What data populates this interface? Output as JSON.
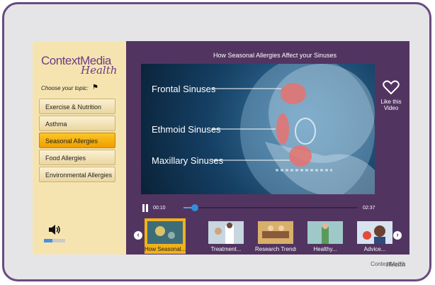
{
  "sidebar": {
    "logo_line1": "ContextMedia",
    "logo_line2": "Health",
    "choose_label": "Choose your topic:",
    "topics": [
      {
        "label": "Exercise & Nutrition"
      },
      {
        "label": "Asthma"
      },
      {
        "label": "Seasonal Allergies",
        "active": true
      },
      {
        "label": "Food Allergies"
      },
      {
        "label": "Environmental Allergies"
      }
    ],
    "volume_level": 0.4
  },
  "player": {
    "title": "How Seasonal Allergies Affect your Sinuses",
    "video_labels": [
      "Frontal Sinuses",
      "Ethmoid Sinuses",
      "Maxillary Sinuses"
    ],
    "like_label": "Like this Video",
    "current_time": "00:10",
    "total_time": "02:37",
    "progress_seconds": 10,
    "duration_seconds": 157
  },
  "thumbnails": [
    {
      "caption": "How Seasonal...",
      "active": true
    },
    {
      "caption": "Treatment..."
    },
    {
      "caption": "Research Trends"
    },
    {
      "caption": "Healthy..."
    },
    {
      "caption": "Advice..."
    }
  ],
  "colors": {
    "purple": "#523461",
    "gold": "#f1b11b",
    "cream": "#f6e4b0",
    "blue": "#2f8fd8"
  },
  "brand": {
    "line1": "ContextMedia",
    "line2": "Health"
  }
}
